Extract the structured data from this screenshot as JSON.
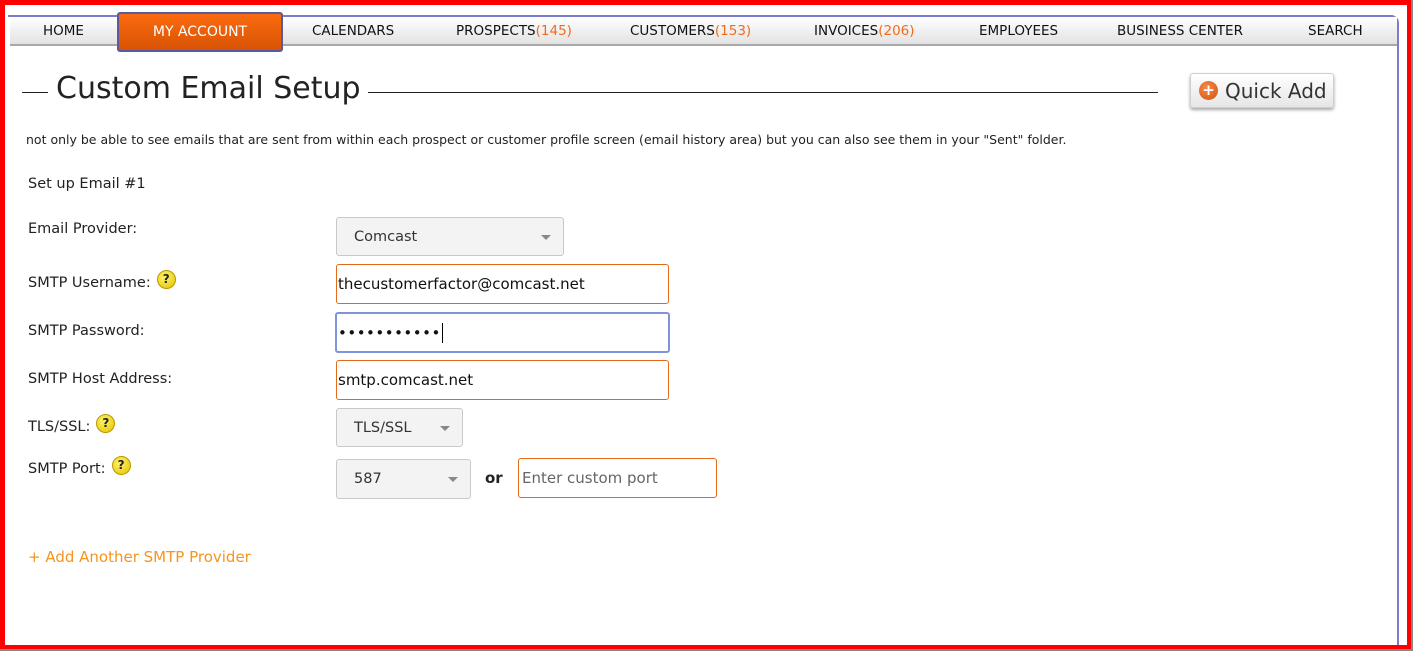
{
  "nav": {
    "items": [
      {
        "label": "HOME",
        "count": null
      },
      {
        "label": "MY ACCOUNT",
        "count": null,
        "active": true
      },
      {
        "label": "CALENDARS",
        "count": null
      },
      {
        "label": "PROSPECTS",
        "count": "(145)"
      },
      {
        "label": "CUSTOMERS",
        "count": "(153)"
      },
      {
        "label": "INVOICES",
        "count": "(206)"
      },
      {
        "label": "EMPLOYEES",
        "count": null
      },
      {
        "label": "BUSINESS CENTER",
        "count": null
      },
      {
        "label": "SEARCH",
        "count": null
      }
    ]
  },
  "header": {
    "title": "Custom Email Setup",
    "quick_add_label": "Quick Add",
    "quick_add_icon": "plus-circle-icon"
  },
  "description": "not only be able to see emails that are sent from within each prospect or customer profile screen (email history area) but you can also see them in your \"Sent\" folder.",
  "form": {
    "section_label": "Set up Email #1",
    "email_provider": {
      "label": "Email Provider:",
      "value": "Comcast"
    },
    "smtp_username": {
      "label": "SMTP Username:",
      "value": "thecustomerfactor@comcast.net",
      "help_icon": "?"
    },
    "smtp_password": {
      "label": "SMTP Password:",
      "masked_value": "•••••••••••"
    },
    "smtp_host": {
      "label": "SMTP Host Address:",
      "value": "smtp.comcast.net"
    },
    "tls_ssl": {
      "label": "TLS/SSL:",
      "value": "TLS/SSL",
      "help_icon": "?"
    },
    "smtp_port": {
      "label": "SMTP Port:",
      "value": "587",
      "help_icon": "?",
      "or_label": "or",
      "custom_placeholder": "Enter custom port"
    },
    "add_another_label": "+ Add Another SMTP Provider"
  },
  "colors": {
    "accent_orange": "#f26b1d",
    "link_orange": "#f7941d",
    "frame_red": "#ff0000",
    "panel_border": "#7b7bcf"
  }
}
